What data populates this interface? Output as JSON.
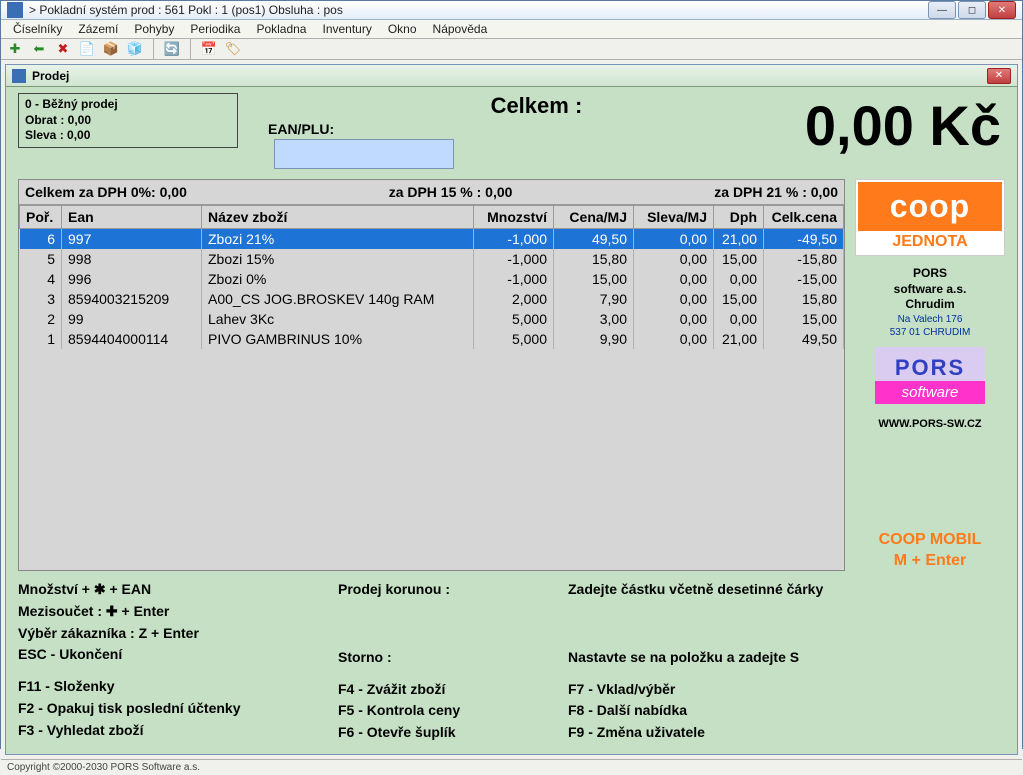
{
  "window": {
    "title": "> Pokladní systém prod : 561 Pokl : 1 (pos1) Obsluha : pos"
  },
  "menu": [
    "Číselníky",
    "Zázemí",
    "Pohyby",
    "Periodika",
    "Pokladna",
    "Inventury",
    "Okno",
    "Nápověda"
  ],
  "subwin": {
    "title": "Prodej"
  },
  "info": {
    "line1": "0 - Běžný prodej",
    "line2": "Obrat : 0,00",
    "line3": "Sleva : 0,00"
  },
  "header": {
    "celkem": "Celkem :",
    "eanlabel": "EAN/PLU:",
    "total": "0,00 Kč"
  },
  "dphsummary": {
    "p0": "Celkem za DPH 0%: 0,00",
    "p15": "za DPH 15 % : 0,00",
    "p21": "za DPH 21 % : 0,00"
  },
  "columns": [
    "Poř.",
    "Ean",
    "Název zboží",
    "Mnozství",
    "Cena/MJ",
    "Sleva/MJ",
    "Dph",
    "Celk.cena"
  ],
  "rows": [
    {
      "por": "6",
      "ean": "997",
      "nazev": "Zbozi 21%",
      "mn": "-1,000",
      "cena": "49,50",
      "sleva": "0,00",
      "dph": "21,00",
      "celk": "-49,50",
      "sel": true
    },
    {
      "por": "5",
      "ean": "998",
      "nazev": "Zbozi 15%",
      "mn": "-1,000",
      "cena": "15,80",
      "sleva": "0,00",
      "dph": "15,00",
      "celk": "-15,80"
    },
    {
      "por": "4",
      "ean": "996",
      "nazev": "Zbozi 0%",
      "mn": "-1,000",
      "cena": "15,00",
      "sleva": "0,00",
      "dph": "0,00",
      "celk": "-15,00"
    },
    {
      "por": "3",
      "ean": "8594003215209",
      "nazev": "A00_CS JOG.BROSKEV 140g RAM",
      "mn": "2,000",
      "cena": "7,90",
      "sleva": "0,00",
      "dph": "15,00",
      "celk": "15,80"
    },
    {
      "por": "2",
      "ean": "99",
      "nazev": "Lahev 3Kc",
      "mn": "5,000",
      "cena": "3,00",
      "sleva": "0,00",
      "dph": "0,00",
      "celk": "15,00"
    },
    {
      "por": "1",
      "ean": "8594404000114",
      "nazev": "PIVO GAMBRINUS 10%",
      "mn": "5,000",
      "cena": "9,90",
      "sleva": "0,00",
      "dph": "21,00",
      "celk": "49,50"
    }
  ],
  "side": {
    "coop": "coop",
    "jednota": "JEDNOTA",
    "porsname": "PORS",
    "porssub": "software a.s.",
    "city": "Chrudim",
    "addr1": "Na Valech 176",
    "addr2": "537 01 CHRUDIM",
    "logo1": "PORS",
    "logo2": "software",
    "url": "WWW.PORS-SW.CZ",
    "mobil1": "COOP MOBIL",
    "mobil2": "M + Enter"
  },
  "help": {
    "l1": "Množství + ✱  + EAN",
    "l2": "Mezisoučet :  ✚  + Enter",
    "l3": "Výběr zákazníka : Z + Enter",
    "l4": "ESC - Ukončení",
    "l5": "F11 - Složenky",
    "l6": "F2 - Opakuj tisk poslední účtenky",
    "l7": "F3 - Vyhledat zboží",
    "pk_lbl": "Prodej korunou :",
    "pk_val": "Zadejte částku včetně desetinné čárky",
    "st_lbl": "Storno :",
    "st_val": "Nastavte se na položku a zadejte S",
    "c2a": "F4 - Zvážit zboží",
    "c2b": "F5 - Kontrola ceny",
    "c2c": "F6 - Otevře šuplík",
    "c3a": "F7 - Vklad/výběr",
    "c3b": "F8 - Další nabídka",
    "c3c": "F9 - Změna uživatele"
  },
  "footer": "Copyright ©2000-2030 PORS Software a.s."
}
